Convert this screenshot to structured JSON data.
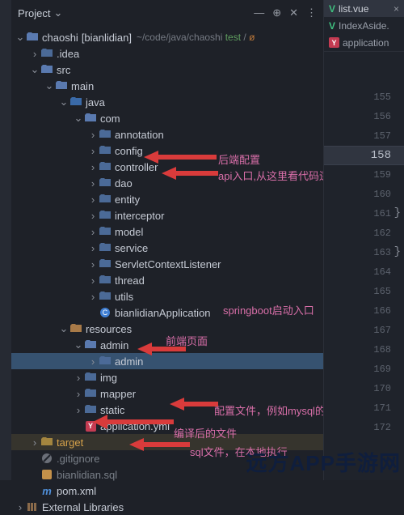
{
  "panel": {
    "title": "Project",
    "tools": [
      "—",
      "⊕",
      "✕",
      "⋮"
    ]
  },
  "root": {
    "name": "chaoshi",
    "alias": "[bianlidian]",
    "path": "~/code/java/chaoshi",
    "pathTag1": "test",
    "pathTag2": "/",
    "pathTag3": "ø"
  },
  "tree": {
    "idea": ".idea",
    "src": "src",
    "main": "main",
    "java": "java",
    "com": "com",
    "annotation": "annotation",
    "config": "config",
    "controller": "controller",
    "dao": "dao",
    "entity": "entity",
    "interceptor": "interceptor",
    "model": "model",
    "service": "service",
    "scl": "ServletContextListener",
    "thread": "thread",
    "utils": "utils",
    "app": "bianlidianApplication",
    "resources": "resources",
    "admin1": "admin",
    "admin2": "admin",
    "img": "img",
    "mapper": "mapper",
    "static": "static",
    "appyml": "application.yml",
    "target": "target",
    "gitignore": ".gitignore",
    "sql": "bianlidian.sql",
    "pom": "pom.xml",
    "extlib": "External Libraries"
  },
  "annotations": {
    "a1": "后端配置",
    "a2": "api入口,从这里看代码逻辑",
    "a3": "springboot启动入口",
    "a4": "前端页面",
    "a5": "配置文件，例如mysql的配置地址",
    "a6": "编译后的文件",
    "a7": "sql文件，在本地执行"
  },
  "tabs": {
    "t1": "list.vue",
    "t2": "IndexAside.",
    "t3": "application"
  },
  "lines": {
    "start": 155,
    "end": 172,
    "current": 158,
    "brace1": "}",
    "brace2": "}"
  },
  "watermark": "远方APP手游网"
}
